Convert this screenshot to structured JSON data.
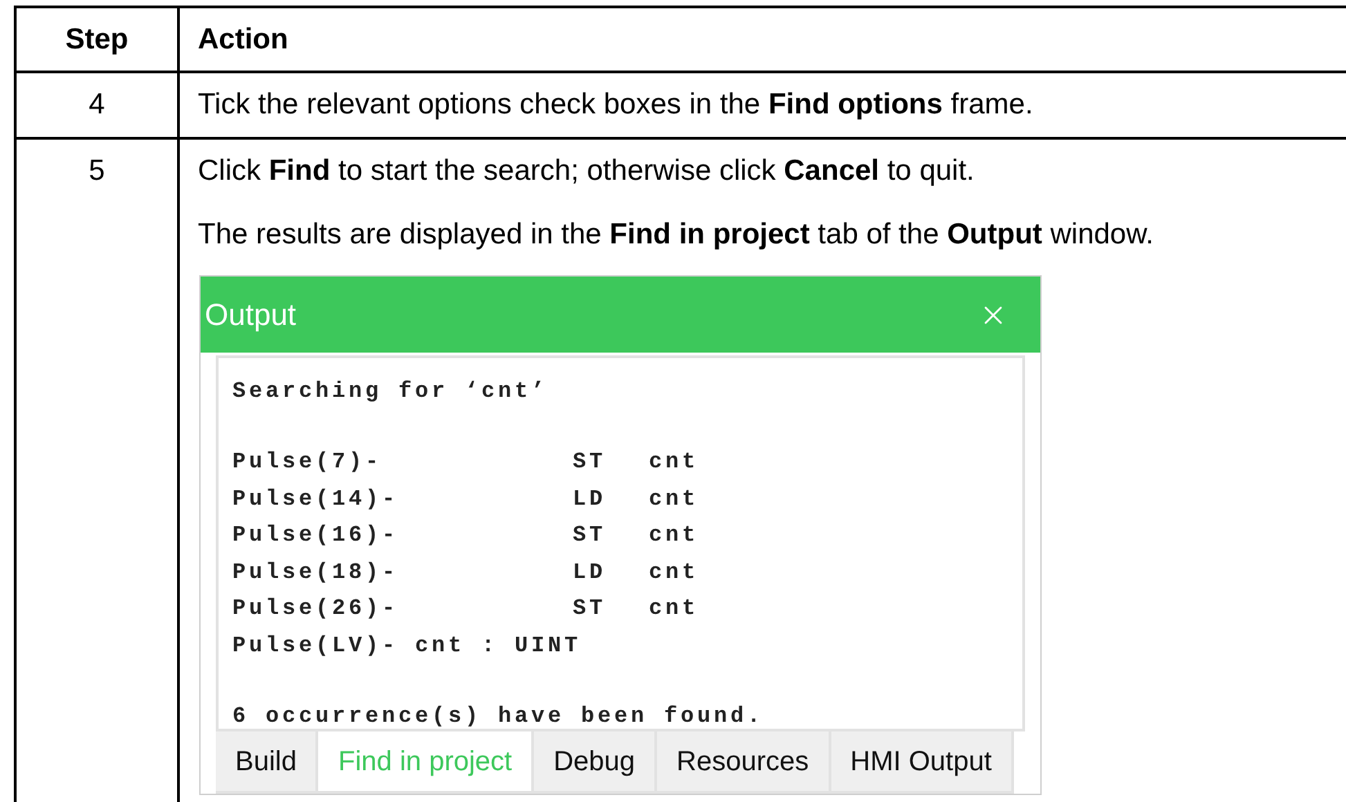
{
  "table": {
    "columns": [
      "Step",
      "Action"
    ],
    "rows": [
      {
        "step": "4",
        "paragraphs": [
          "Tick the relevant options check boxes in the **Find options** frame."
        ]
      },
      {
        "step": "5",
        "paragraphs": [
          "Click **Find** to start the search; otherwise click **Cancel** to quit.",
          "The results are displayed in the **Find in project** tab of the **Output** window."
        ],
        "output_window": {
          "title": "Output",
          "lines": [
            {
              "kind": "heading",
              "text": "Searching for ‘cnt’"
            },
            {
              "kind": "entry",
              "location": "Pulse(7)-",
              "operation": "ST",
              "operand": "cnt"
            },
            {
              "kind": "entry",
              "location": "Pulse(14)-",
              "operation": "LD",
              "operand": "cnt"
            },
            {
              "kind": "entry",
              "location": "Pulse(16)-",
              "operation": "ST",
              "operand": "cnt"
            },
            {
              "kind": "entry",
              "location": "Pulse(18)-",
              "operation": "LD",
              "operand": "cnt"
            },
            {
              "kind": "entry",
              "location": "Pulse(26)-",
              "operation": "ST",
              "operand": "cnt"
            },
            {
              "kind": "declaration",
              "text": "Pulse(LV)- cnt : UINT"
            },
            {
              "kind": "summary",
              "text": "6 occurrence(s) have been found."
            }
          ],
          "tabs": [
            {
              "label": "Build",
              "selected": false
            },
            {
              "label": "Find in project",
              "selected": true
            },
            {
              "label": "Debug",
              "selected": false
            },
            {
              "label": "Resources",
              "selected": false
            },
            {
              "label": "HMI Output",
              "selected": false
            }
          ]
        }
      }
    ]
  }
}
